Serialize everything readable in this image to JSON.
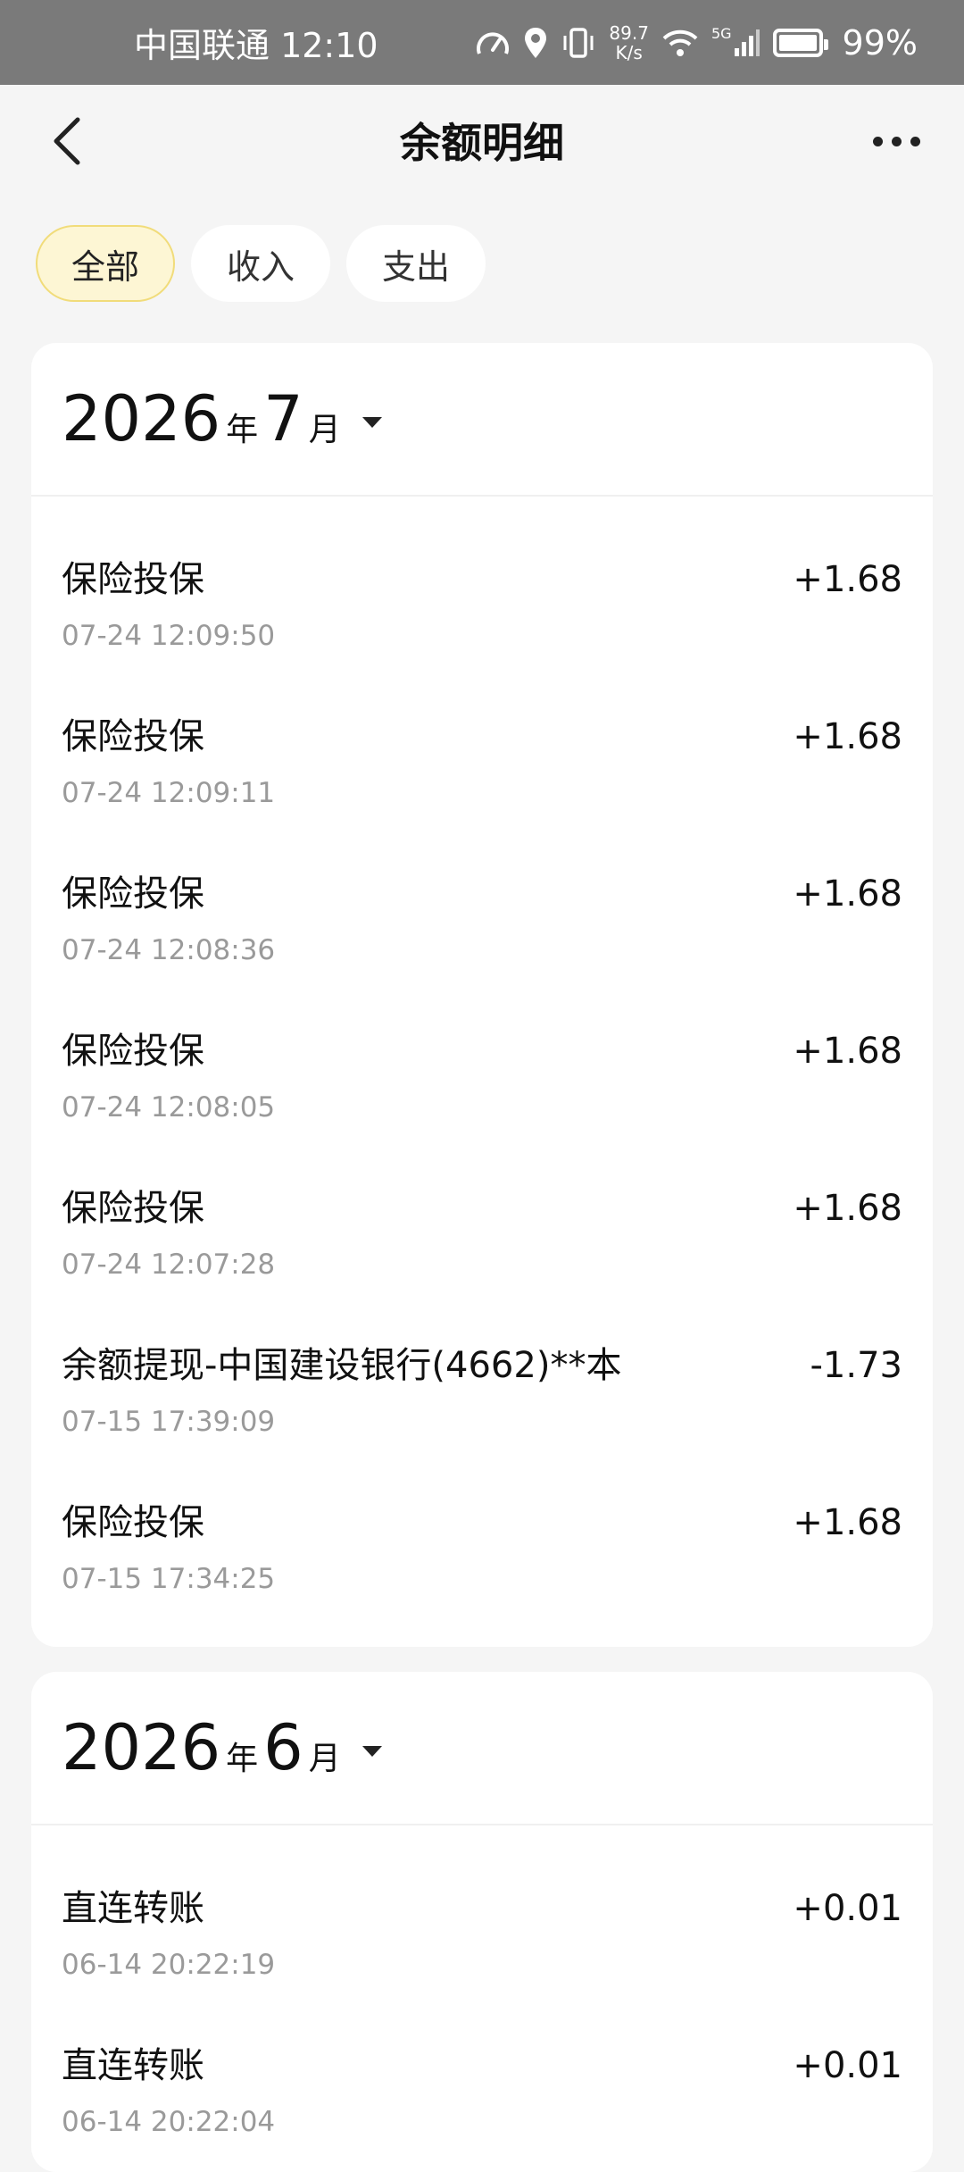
{
  "status_bar": {
    "carrier_time": "中国联通 12:10",
    "net_speed_value": "89.7",
    "net_speed_unit": "K/s",
    "network": "5G",
    "battery": "99%"
  },
  "nav": {
    "title": "余额明细"
  },
  "filters": [
    {
      "label": "全部",
      "active": true
    },
    {
      "label": "收入",
      "active": false
    },
    {
      "label": "支出",
      "active": false
    }
  ],
  "months": [
    {
      "year": "2026",
      "year_unit": "年",
      "month": "7",
      "month_unit": "月",
      "transactions": [
        {
          "title": "保险投保",
          "time": "07-24 12:09:50",
          "amount": "+1.68"
        },
        {
          "title": "保险投保",
          "time": "07-24 12:09:11",
          "amount": "+1.68"
        },
        {
          "title": "保险投保",
          "time": "07-24 12:08:36",
          "amount": "+1.68"
        },
        {
          "title": "保险投保",
          "time": "07-24 12:08:05",
          "amount": "+1.68"
        },
        {
          "title": "保险投保",
          "time": "07-24 12:07:28",
          "amount": "+1.68"
        },
        {
          "title": "余额提现-中国建设银行(4662)**本",
          "time": "07-15 17:39:09",
          "amount": "-1.73"
        },
        {
          "title": "保险投保",
          "time": "07-15 17:34:25",
          "amount": "+1.68"
        }
      ]
    },
    {
      "year": "2026",
      "year_unit": "年",
      "month": "6",
      "month_unit": "月",
      "transactions": [
        {
          "title": "直连转账",
          "time": "06-14 20:22:19",
          "amount": "+0.01"
        },
        {
          "title": "直连转账",
          "time": "06-14 20:22:04",
          "amount": "+0.01"
        }
      ]
    }
  ]
}
